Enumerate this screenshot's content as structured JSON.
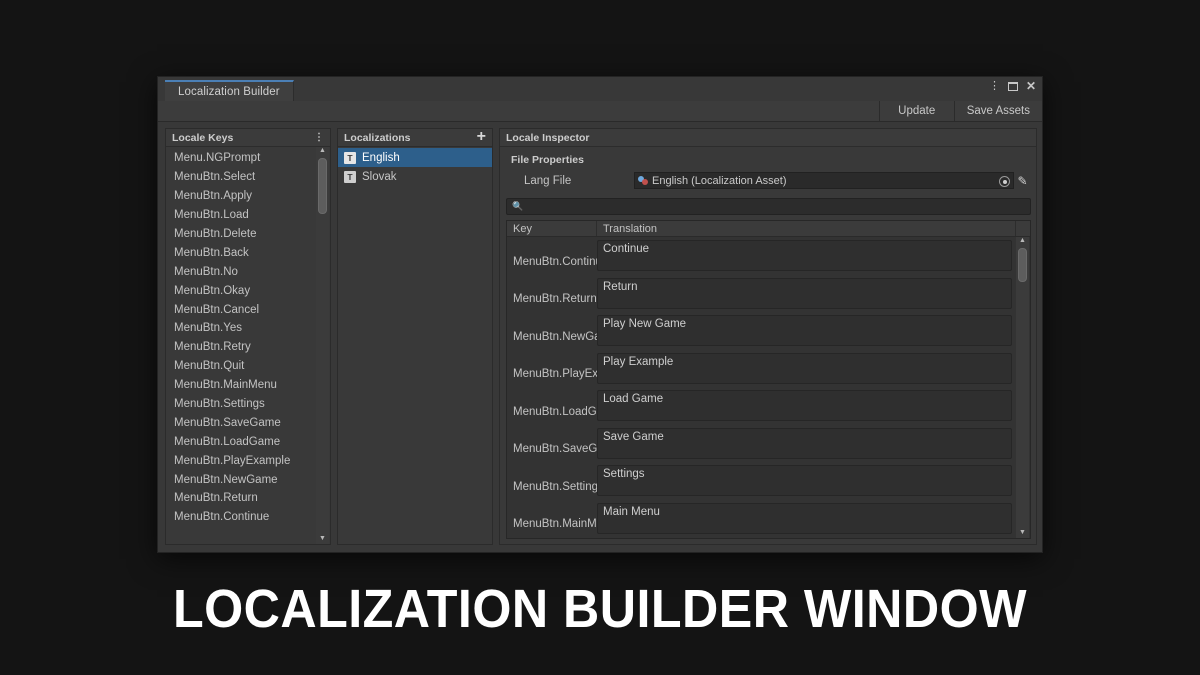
{
  "caption": "LOCALIZATION BUILDER WINDOW",
  "window": {
    "tab_label": "Localization Builder",
    "controls": {
      "kebab": "⋮",
      "maximize": "maximize-icon",
      "close": "✕"
    },
    "toolbar": {
      "update_label": "Update",
      "save_assets_label": "Save Assets"
    }
  },
  "locale_keys": {
    "title": "Locale Keys",
    "menu_icon": "⋮",
    "items": [
      "MenuBtn.Continue",
      "MenuBtn.Return",
      "MenuBtn.NewGame",
      "MenuBtn.PlayExample",
      "MenuBtn.LoadGame",
      "MenuBtn.SaveGame",
      "MenuBtn.Settings",
      "MenuBtn.MainMenu",
      "MenuBtn.Quit",
      "MenuBtn.Retry",
      "MenuBtn.Yes",
      "MenuBtn.Cancel",
      "MenuBtn.Okay",
      "MenuBtn.No",
      "MenuBtn.Back",
      "MenuBtn.Delete",
      "MenuBtn.Load",
      "MenuBtn.Apply",
      "MenuBtn.Select",
      "Menu.NGPrompt"
    ]
  },
  "localizations": {
    "title": "Localizations",
    "add_icon": "+",
    "items": [
      {
        "label": "English",
        "badge": "T",
        "selected": true
      },
      {
        "label": "Slovak",
        "badge": "T",
        "selected": false
      }
    ]
  },
  "inspector": {
    "title": "Locale Inspector",
    "section_title": "File Properties",
    "lang_file_label": "Lang File",
    "lang_file_value": "English (Localization Asset)",
    "search_placeholder": "",
    "search_value": "",
    "table": {
      "col_key": "Key",
      "col_translation": "Translation",
      "rows": [
        {
          "key": "MenuBtn.Continue",
          "translation": "Continue"
        },
        {
          "key": "MenuBtn.Return",
          "translation": "Return"
        },
        {
          "key": "MenuBtn.NewGame",
          "translation": "Play New Game"
        },
        {
          "key": "MenuBtn.PlayExample",
          "translation": "Play Example"
        },
        {
          "key": "MenuBtn.LoadGame",
          "translation": "Load Game"
        },
        {
          "key": "MenuBtn.SaveGame",
          "translation": "Save Game"
        },
        {
          "key": "MenuBtn.Settings",
          "translation": "Settings"
        },
        {
          "key": "MenuBtn.MainMenu",
          "translation": "Main Menu"
        }
      ]
    }
  },
  "colors": {
    "accent_blue": "#2d5f8b",
    "tab_active_border": "#4b7fb5",
    "window_bg": "#383838",
    "panel_bg": "#393939"
  }
}
